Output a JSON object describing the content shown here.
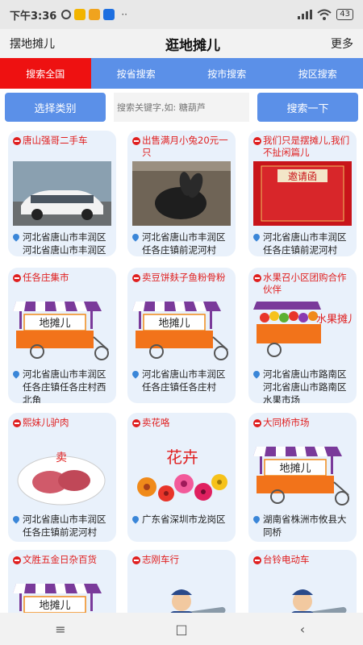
{
  "status": {
    "time": "下午3:36",
    "dots": "··",
    "battery": "43"
  },
  "title_bar": {
    "left": "摆地摊儿",
    "center": "逛地摊儿",
    "right": "更多"
  },
  "tabs": [
    "搜索全国",
    "按省搜索",
    "按市搜索",
    "按区搜索"
  ],
  "search": {
    "category_button": "选择类别",
    "placeholder": "搜索关键字,如: 糖葫芦",
    "search_button": "搜索一下"
  },
  "cards": [
    {
      "title": "唐山强哥二手车",
      "location": "河北省唐山市丰润区河北省唐山市丰润区",
      "image": "car-photo"
    },
    {
      "title": "出售满月小兔20元一只",
      "location": "河北省唐山市丰润区任各庄镇前泥河村",
      "image": "rabbit-photo"
    },
    {
      "title": "我们只是摆摊儿,我们不扯闲篇儿",
      "location": "河北省唐山市丰润区任各庄镇前泥河村",
      "image": "red-banner-photo",
      "banner_text": "邀请函"
    },
    {
      "title": "任各庄集市",
      "location": "河北省唐山市丰润区任各庄镇任各庄村西北角",
      "image": "stall-cart",
      "cart_text": "地摊儿"
    },
    {
      "title": "卖豆饼麸子鱼粉骨粉",
      "location": "河北省唐山市丰润区任各庄镇任各庄村",
      "image": "stall-cart",
      "cart_text": "地摊儿"
    },
    {
      "title": "水果召小区团购合作伙伴",
      "location": "河北省唐山市路南区河北省唐山市路南区水果市场",
      "image": "fruit-cart",
      "cart_text": "水果摊儿"
    },
    {
      "title": "熙妹儿驴肉",
      "location": "河北省唐山市丰润区任各庄镇前泥河村",
      "image": "meat-plate",
      "cart_text": "卖"
    },
    {
      "title": "卖花咯",
      "location": "广东省深圳市龙岗区",
      "image": "flowers",
      "cart_text": "花卉"
    },
    {
      "title": "大同桥市场",
      "location": "湖南省株洲市攸县大同桥",
      "image": "stall-cart",
      "cart_text": "地摊儿"
    },
    {
      "title": "文胜五金日杂百货",
      "location": "",
      "image": "stall-cart",
      "cart_text": "地摊儿"
    },
    {
      "title": "志刚车行",
      "location": "",
      "image": "mechanic"
    },
    {
      "title": "台铃电动车",
      "location": "",
      "image": "mechanic"
    }
  ],
  "colors": {
    "accent": "#5b90e8",
    "active_tab": "#ee1111",
    "card_bg": "#e9f1fb",
    "title_red": "#e02020"
  },
  "nav": {
    "menu": "≡",
    "home": "□",
    "back": "‹"
  }
}
